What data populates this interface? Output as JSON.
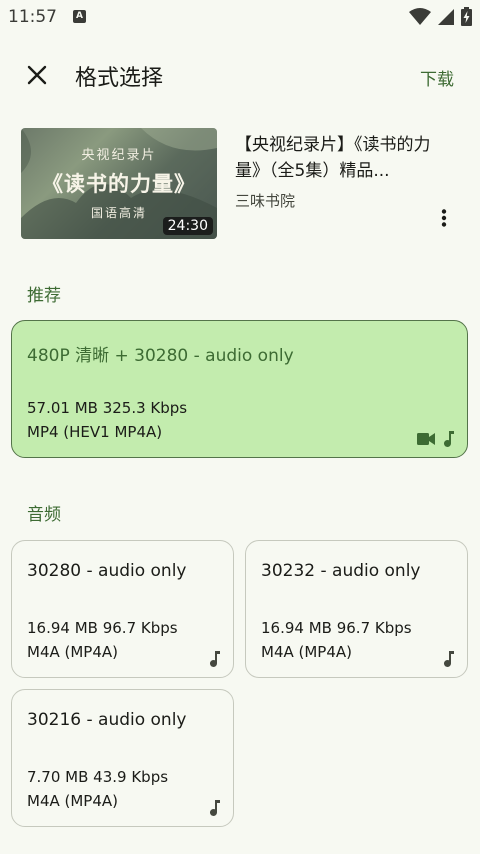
{
  "status_bar": {
    "time": "11:57",
    "notification_badge": "A"
  },
  "app_bar": {
    "title": "格式选择",
    "action_label": "下载"
  },
  "video": {
    "thumbnail_line1": "央视纪录片",
    "thumbnail_line2": "《读书的力量》",
    "thumbnail_line3": "国语高清",
    "duration": "24:30",
    "title": "【央视纪录片】《读书的力量》（全5集）精品...",
    "channel": "三味书院"
  },
  "sections": {
    "recommended_label": "推荐",
    "audio_label": "音频"
  },
  "recommended_format": {
    "title": "480P 清晰 + 30280 - audio only",
    "size_bitrate": "57.01 MB 325.3 Kbps",
    "format": "MP4 (HEV1 MP4A)",
    "icons": [
      "video-icon",
      "music-note-icon"
    ]
  },
  "audio_formats": [
    {
      "title": "30280 - audio only",
      "size_bitrate": "16.94 MB 96.7 Kbps",
      "format": "M4A (MP4A)",
      "icon": "music-note-icon"
    },
    {
      "title": "30232 - audio only",
      "size_bitrate": "16.94 MB 96.7 Kbps",
      "format": "M4A (MP4A)",
      "icon": "music-note-icon"
    },
    {
      "title": "30216 - audio only",
      "size_bitrate": "7.70 MB 43.9 Kbps",
      "format": "M4A (MP4A)",
      "icon": "music-note-icon"
    }
  ],
  "colors": {
    "accent": "#3d6b33",
    "selected_card_bg": "#c3ecae",
    "background": "#f7f9f2"
  }
}
